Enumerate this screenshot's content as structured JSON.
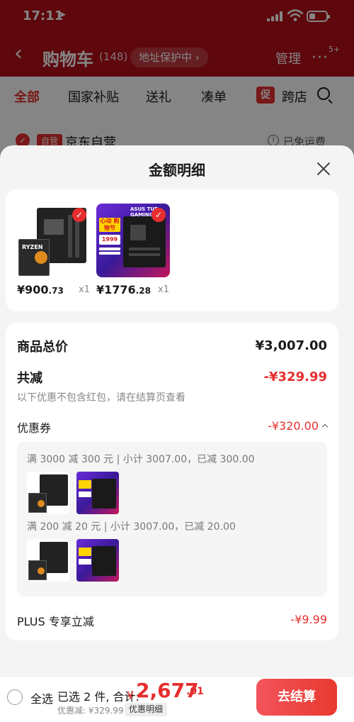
{
  "status_bar": {
    "time": "17:11",
    "arrow": "➤"
  },
  "nav": {
    "back": "‹",
    "title": "购物车",
    "count": "(148)",
    "address_protect": "地址保护中 ›",
    "manage": "管理",
    "more_badge": "5+"
  },
  "tabs": [
    {
      "label": "全部"
    },
    {
      "label": "国家补贴"
    },
    {
      "label": "送礼"
    },
    {
      "label": "凑单"
    },
    {
      "label": "跨店"
    }
  ],
  "tab_promo": "促",
  "store": {
    "tag": "自营",
    "name": "京东自营",
    "info": "i",
    "shipping": "已免运费"
  },
  "sheet": {
    "title": "金额明细",
    "products": [
      {
        "price_int": "¥900",
        "price_dec": ".73",
        "qty": "x1"
      },
      {
        "price_int": "¥1776",
        "price_dec": ".28",
        "qty": "x1"
      }
    ],
    "product_b_art": {
      "tag": "心动 购物节",
      "price": "1999",
      "brand": "ASUS  TUF GAMING"
    },
    "product_a_art": {
      "box": "RYZEN"
    },
    "summary": {
      "total_label": "商品总价",
      "total_value": "¥3,007.00",
      "discount_label": "共减",
      "discount_value": "-¥329.99",
      "discount_note": "以下优惠不包含红包，请在结算页查看",
      "coupon_label": "优惠券",
      "coupon_value": "-¥320.00",
      "coupon_lines": [
        "满 3000 减 300 元 | 小计 3007.00，已减 300.00",
        "满 200 减 20 元 | 小计 3007.00，已减 20.00"
      ],
      "plus_label": "PLUS 专享立减",
      "plus_value": "-¥9.99"
    }
  },
  "bottom_bar": {
    "select_all": "全选",
    "selected_summary": "已选 2 件, 合计:",
    "total_currency": "¥",
    "total_int": "2,677",
    "total_dec": ".01",
    "discount_text": "优惠减: ¥329.99",
    "discount_detail_btn": "优惠明细",
    "checkout": "去结算"
  },
  "colors": {
    "accent": "#e62e2e",
    "header_bg": "#b50f17",
    "sheet_bg": "#f4f4f4"
  }
}
